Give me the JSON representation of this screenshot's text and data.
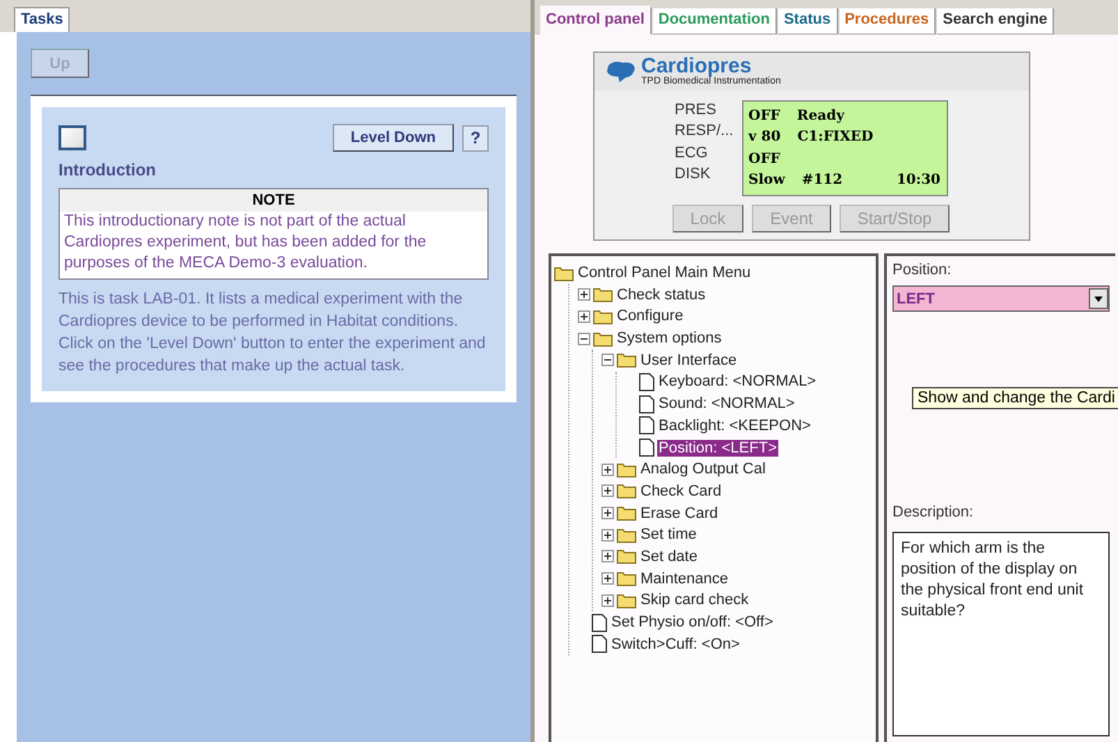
{
  "left_tabs": [
    {
      "label": "Tasks",
      "selected": true
    }
  ],
  "up_button": {
    "label": "Up",
    "disabled": true
  },
  "task": {
    "checked": false,
    "level_down": "Level Down",
    "help": "?",
    "title": "Introduction",
    "note": {
      "heading": "NOTE",
      "text": "This introductionary note is not part of the actual Cardiopres experiment, but has been added for the purposes of the MECA Demo-3 evaluation."
    },
    "description": "This is task LAB-01. It lists a medical experiment with the Cardiopres device to be performed in Habitat conditions. Click on the 'Level Down' button to enter the experiment and see the procedures that make up the actual task."
  },
  "tabs": [
    {
      "label": "Control panel",
      "selected": true,
      "color": "#8a3a8a"
    },
    {
      "label": "Documentation",
      "selected": false,
      "color": "#2a9a5a"
    },
    {
      "label": "Status",
      "selected": false,
      "color": "#1a6a8a"
    },
    {
      "label": "Procedures",
      "selected": false,
      "color": "#c8641e"
    },
    {
      "label": "Search engine",
      "selected": false,
      "color": "#333333"
    }
  ],
  "device": {
    "brand": "Cardiopres",
    "maker": "TPD Biomedical Instrumentation",
    "rows": [
      {
        "label": "PRES",
        "cells": [
          "OFF",
          "Ready"
        ]
      },
      {
        "label": "RESP/...",
        "cells": [
          "v 80",
          "C1:FIXED"
        ]
      },
      {
        "label": "ECG",
        "cells": [
          "OFF"
        ]
      },
      {
        "label": "DISK",
        "cells": [
          "Slow",
          "#112",
          "10:30"
        ]
      }
    ],
    "buttons": [
      {
        "label": "Lock",
        "disabled": true
      },
      {
        "label": "Event",
        "disabled": true
      },
      {
        "label": "Start/Stop",
        "disabled": true
      }
    ]
  },
  "tree": {
    "kind": "folder",
    "label": "Control Panel Main Menu",
    "selected": false,
    "children": [
      {
        "kind": "folder",
        "label": "Check status",
        "expanded": false,
        "selected": false
      },
      {
        "kind": "folder",
        "label": "Configure",
        "expanded": false,
        "selected": false
      },
      {
        "kind": "folder",
        "label": "System options",
        "expanded": true,
        "selected": false,
        "children": [
          {
            "kind": "folder",
            "label": "User Interface",
            "expanded": true,
            "selected": false,
            "children": [
              {
                "kind": "item",
                "label": "Keyboard: <NORMAL>",
                "selected": false
              },
              {
                "kind": "item",
                "label": "Sound: <NORMAL>",
                "selected": false
              },
              {
                "kind": "item",
                "label": "Backlight: <KEEPON>",
                "selected": false
              },
              {
                "kind": "item",
                "label": "Position: <LEFT>",
                "selected": true
              }
            ]
          },
          {
            "kind": "folder",
            "label": "Analog Output Cal",
            "expanded": false,
            "selected": false
          },
          {
            "kind": "folder",
            "label": "Check Card",
            "expanded": false,
            "selected": false
          },
          {
            "kind": "folder",
            "label": "Erase Card",
            "expanded": false,
            "selected": false
          },
          {
            "kind": "folder",
            "label": "Set time",
            "expanded": false,
            "selected": false
          },
          {
            "kind": "folder",
            "label": "Set date",
            "expanded": false,
            "selected": false
          },
          {
            "kind": "folder",
            "label": "Maintenance",
            "expanded": false,
            "selected": false
          },
          {
            "kind": "folder",
            "label": "Skip card check",
            "expanded": false,
            "selected": false
          }
        ]
      },
      {
        "kind": "item",
        "label": "Set Physio on/off: <Off>",
        "selected": false
      },
      {
        "kind": "item",
        "label": "Switch>Cuff: <On>",
        "selected": false
      }
    ]
  },
  "detail": {
    "field_label": "Position:",
    "value": "LEFT",
    "tooltip": "Show and change the Cardi",
    "description_label": "Description:",
    "description": "For which arm is the position of the display on the physical front end unit suitable?"
  }
}
